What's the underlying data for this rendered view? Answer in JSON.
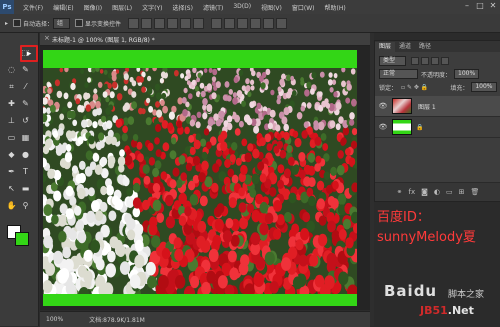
{
  "app": {
    "logo": "Ps"
  },
  "menu": {
    "items": [
      "文件(F)",
      "编辑(E)",
      "图像(I)",
      "图层(L)",
      "文字(Y)",
      "选择(S)",
      "滤镜(T)",
      "3D(D)",
      "视图(V)",
      "窗口(W)",
      "帮助(H)"
    ]
  },
  "window_controls": {
    "minimize": "–",
    "maximize": "□",
    "close": "✕"
  },
  "options": {
    "auto_select_label": "自动选择：",
    "auto_select_value": "组",
    "transform_label": "显示变换控件"
  },
  "document": {
    "tab_title": "未标题-1 @ 100% (图层 1, RGB/8) *",
    "close_glyph": "×",
    "zoom": "100%",
    "doc_size": "文档:878.9K/1.81M",
    "colors": {
      "frame": "#33d616",
      "canvas_bg": "#252525"
    }
  },
  "panel": {
    "tabs": [
      "图层",
      "通道",
      "路径"
    ],
    "kind_label": "类型",
    "blend_mode": "正常",
    "opacity_label": "不透明度：",
    "opacity_value": "100%",
    "lock_label": "锁定：",
    "fill_label": "填充：",
    "fill_value": "100%",
    "layers": [
      {
        "name": "图层 1",
        "eye": "👁"
      },
      {
        "name": "",
        "eye": "👁"
      }
    ],
    "footer_icons": [
      "link-icon",
      "fx-icon",
      "mask-icon",
      "adjustment-icon",
      "folder-icon",
      "new-layer-icon",
      "trash-icon"
    ]
  },
  "tools": [
    {
      "name": "move-tool",
      "glyph": "▸"
    },
    {
      "name": "marquee-tool",
      "glyph": "⬚"
    },
    {
      "name": "lasso-tool",
      "glyph": "◌"
    },
    {
      "name": "quick-select-tool",
      "glyph": "✎"
    },
    {
      "name": "crop-tool",
      "glyph": "⌗"
    },
    {
      "name": "eyedropper-tool",
      "glyph": "⁄"
    },
    {
      "name": "heal-tool",
      "glyph": "✚"
    },
    {
      "name": "brush-tool",
      "glyph": "✎"
    },
    {
      "name": "stamp-tool",
      "glyph": "⊥"
    },
    {
      "name": "history-brush-tool",
      "glyph": "↺"
    },
    {
      "name": "eraser-tool",
      "glyph": "▭"
    },
    {
      "name": "gradient-tool",
      "glyph": "▦"
    },
    {
      "name": "blur-tool",
      "glyph": "◆"
    },
    {
      "name": "dodge-tool",
      "glyph": "●"
    },
    {
      "name": "pen-tool",
      "glyph": "✒"
    },
    {
      "name": "type-tool",
      "glyph": "T"
    },
    {
      "name": "path-select-tool",
      "glyph": "↖"
    },
    {
      "name": "shape-tool",
      "glyph": "▬"
    },
    {
      "name": "hand-tool",
      "glyph": "✋"
    },
    {
      "name": "zoom-tool",
      "glyph": "⚲"
    }
  ],
  "swatches": {
    "foreground": "#ffffff",
    "background": "#33d616"
  },
  "annotation": {
    "id_line": "百度ID：",
    "user_line": "sunnyMelody夏",
    "color": "#ff3a3a"
  },
  "watermark": {
    "top": "Baidu",
    "top_sub": "脚本之家",
    "site_prefix": "JB51",
    "site_suffix": ".Net"
  }
}
